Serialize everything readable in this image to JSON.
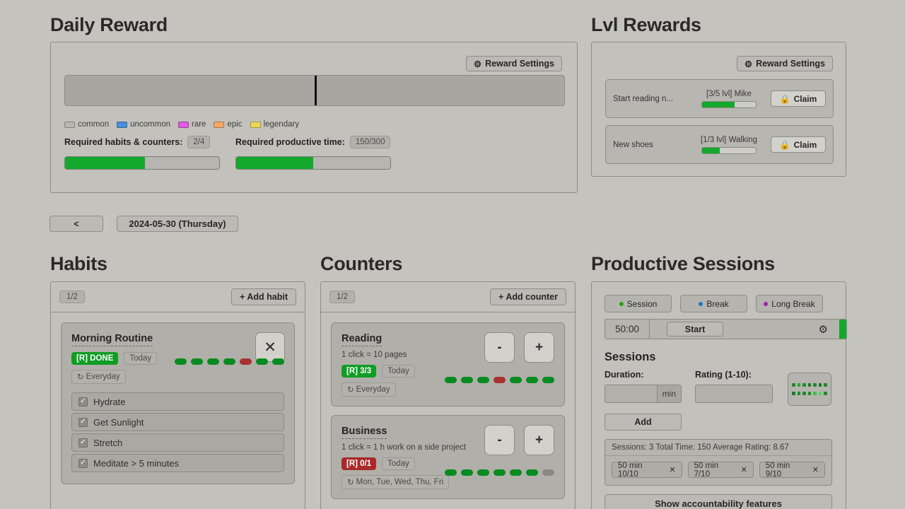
{
  "daily_reward": {
    "title": "Daily Reward",
    "settings_button": "Reward Settings",
    "settings_icon": "gear-icon",
    "bar_divider_pct": 50,
    "legend": [
      {
        "label": "common",
        "color": "#b9b7b1"
      },
      {
        "label": "uncommon",
        "color": "#4a90d9"
      },
      {
        "label": "rare",
        "color": "#e05ce0"
      },
      {
        "label": "epic",
        "color": "#f0a868"
      },
      {
        "label": "legendary",
        "color": "#e8d65a"
      }
    ],
    "requirements": [
      {
        "label": "Required habits & counters:",
        "value": "2/4",
        "fill_pct": 52
      },
      {
        "label": "Required productive time:",
        "value": "150/300",
        "fill_pct": 50
      }
    ]
  },
  "lvl_rewards": {
    "title": "Lvl Rewards",
    "settings_button": "Reward Settings",
    "rows": [
      {
        "name": "Start reading n...",
        "level_label": "[3/5 lvl] Mike",
        "fill_pct": 60,
        "claim_label": "Claim",
        "lock_icon": "lock-icon"
      },
      {
        "name": "New shoes",
        "level_label": "[1/3 lvl] Walking",
        "fill_pct": 33,
        "claim_label": "Claim",
        "lock_icon": "lock-icon"
      }
    ]
  },
  "date_nav": {
    "prev_label": "<",
    "current_date": "2024-05-30 (Thursday)"
  },
  "habits": {
    "title": "Habits",
    "count_badge": "1/2",
    "add_label": "+ Add habit",
    "items": [
      {
        "name": "Morning Routine",
        "status": "[R] DONE",
        "status_type": "done",
        "today_label": "Today",
        "repeat_label": "Everyday",
        "repeat_icon": "repeat-icon",
        "close_icon": "close-icon",
        "dots": [
          "green",
          "green",
          "green",
          "green",
          "red",
          "green",
          "green"
        ],
        "checklist": [
          {
            "label": "Hydrate",
            "checked": true
          },
          {
            "label": "Get Sunlight",
            "checked": true
          },
          {
            "label": "Stretch",
            "checked": true
          },
          {
            "label": "Meditate > 5 minutes",
            "checked": true
          }
        ]
      }
    ]
  },
  "counters": {
    "title": "Counters",
    "count_badge": "1/2",
    "add_label": "+ Add counter",
    "minus_label": "-",
    "plus_label": "+",
    "items": [
      {
        "name": "Reading",
        "subtitle": "1 click = 10 pages",
        "status": "[R] 3/3",
        "status_type": "done",
        "today_label": "Today",
        "repeat_label": "Everyday",
        "dots": [
          "green",
          "green",
          "green",
          "red",
          "green",
          "green",
          "green"
        ]
      },
      {
        "name": "Business",
        "subtitle": "1 click = 1 h work on a side project",
        "status": "[R] 0/1",
        "status_type": "fail",
        "today_label": "Today",
        "repeat_label": "Mon, Tue, Wed, Thu, Fri",
        "dots": [
          "green",
          "green",
          "green",
          "green",
          "green",
          "green",
          "gray"
        ]
      }
    ]
  },
  "sessions": {
    "title": "Productive Sessions",
    "modes": [
      {
        "label": "Session",
        "color": "#1aa61a"
      },
      {
        "label": "Break",
        "color": "#1878c8"
      },
      {
        "label": "Long Break",
        "color": "#9b1fb5"
      }
    ],
    "timer_value": "50:00",
    "start_label": "Start",
    "gear_icon": "gear-icon",
    "accent_color": "#14a82c",
    "subheading": "Sessions",
    "duration_label": "Duration:",
    "duration_value": "",
    "duration_placeholder": "",
    "duration_suffix": "min",
    "rating_label": "Rating (1-10):",
    "rating_value": "",
    "rating_placeholder": "",
    "add_label": "Add",
    "dot_grid": [
      [
        "#1f8a2e",
        "#2aa33a",
        "#1f8a2e",
        "#1a7a28",
        "#1f8a2e",
        "#1a7a28",
        "#1f8a2e"
      ],
      [
        "#1a7a28",
        "#1f8a2e",
        "#1f8a2e",
        "#1f8a2e",
        "#3fbf4a",
        "#4fd45a",
        "#1f8a2e"
      ]
    ],
    "summary": "Sessions: 3 Total Time: 150 Average Rating: 8.67",
    "chips": [
      {
        "label": "50 min 10/10",
        "remove_icon": "close-icon"
      },
      {
        "label": "50 min 7/10",
        "remove_icon": "close-icon"
      },
      {
        "label": "50 min 9/10",
        "remove_icon": "close-icon"
      }
    ],
    "accountability_label": "Show accountability features"
  }
}
